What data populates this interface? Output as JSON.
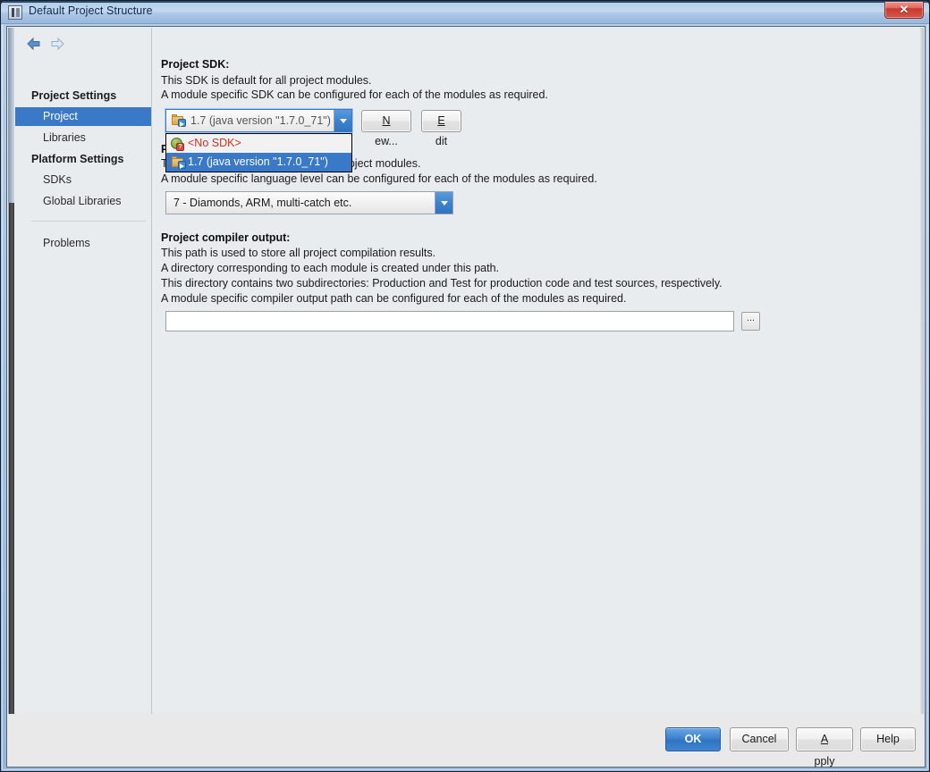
{
  "window": {
    "title": "Default Project Structure",
    "icon": "intellij-idea-icon",
    "close_label": "✕"
  },
  "sidebar": {
    "nav": {
      "back_icon": "arrow-left-icon",
      "forward_icon": "arrow-right-icon"
    },
    "groups": [
      {
        "label": "Project Settings",
        "items": [
          {
            "label": "Project",
            "selected": true
          },
          {
            "label": "Libraries",
            "selected": false
          }
        ]
      },
      {
        "label": "Platform Settings",
        "items": [
          {
            "label": "SDKs",
            "selected": false
          },
          {
            "label": "Global Libraries",
            "selected": false
          }
        ]
      }
    ],
    "extra_items": [
      {
        "label": "Problems",
        "selected": false
      }
    ]
  },
  "main": {
    "sdk_section": {
      "title": "Project SDK:",
      "desc_line_1": "This SDK is default for all project modules.",
      "desc_line_2": "A module specific SDK can be configured for each of the modules as required.",
      "selected_value": "1.7 (java version \"1.7.0_71\")",
      "new_button": {
        "prefix": "",
        "mnemonic": "N",
        "suffix": "ew..."
      },
      "edit_button": {
        "prefix": "",
        "mnemonic": "E",
        "suffix": "dit"
      }
    },
    "sdk_popup": {
      "items": [
        {
          "label": "<No SDK>",
          "icon": "no-sdk-icon",
          "selected": false
        },
        {
          "label": "1.7 (java version \"1.7.0_71\")",
          "icon": "sdk-folder-icon",
          "selected": true
        }
      ]
    },
    "language_section": {
      "title": "Project language level:",
      "desc_line_1": "This language level is default for all project modules.",
      "desc_line_2": "A module specific language level can be configured for each of the modules as required.",
      "selected_value": "7 - Diamonds, ARM, multi-catch etc."
    },
    "compiler_section": {
      "title": "Project compiler output:",
      "desc_line_1": "This path is used to store all project compilation results.",
      "desc_line_2": "A directory corresponding to each module is created under this path.",
      "desc_line_3": "This directory contains two subdirectories: Production and Test for production code and test sources, respectively.",
      "desc_line_4": "A module specific compiler output path can be configured for each of the modules as required.",
      "path_value": "",
      "path_placeholder": "",
      "browse_label": "..."
    }
  },
  "footer": {
    "ok_label": "OK",
    "cancel_label": "Cancel",
    "apply": {
      "mnemonic": "A",
      "suffix": "pply"
    },
    "help_label": "Help"
  },
  "colors": {
    "accent": "#3a78c8",
    "selection": "#3a78c8",
    "error_text": "#cc3322",
    "titlebar_text": "#11294a"
  }
}
